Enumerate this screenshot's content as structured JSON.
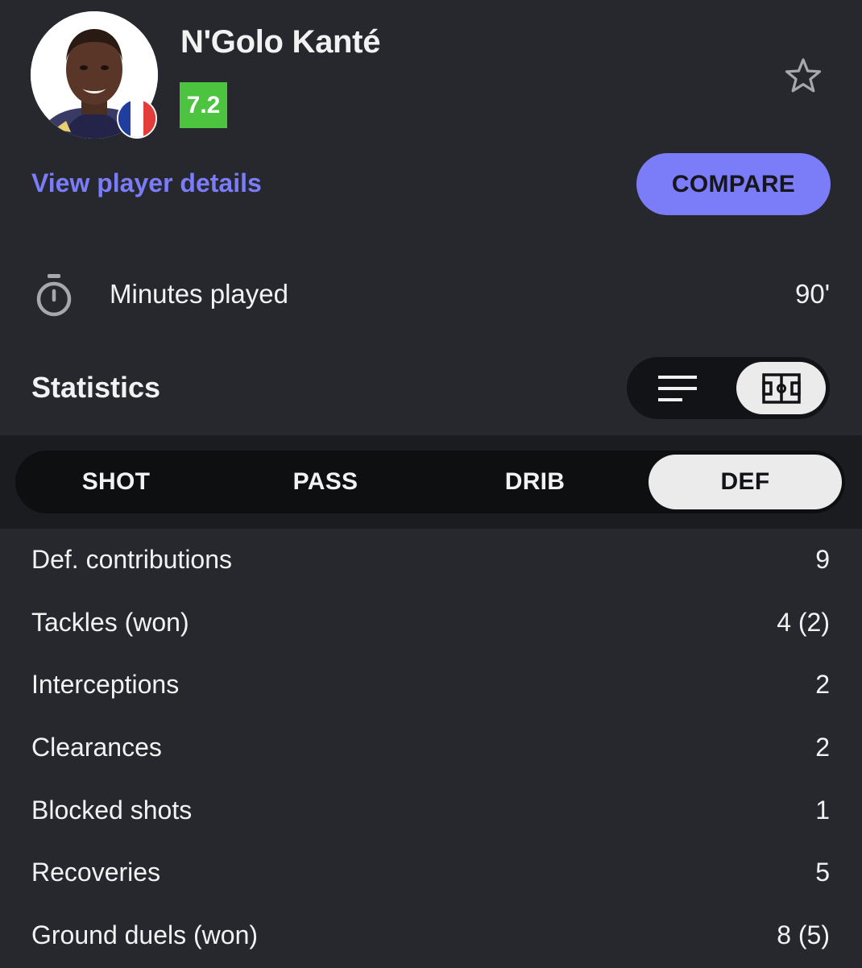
{
  "player": {
    "name": "N'Golo Kanté",
    "rating": "7.2",
    "rating_color": "#4cc43f",
    "country_flag": "france-flag-icon",
    "avatar": "player-photo"
  },
  "actions": {
    "view_details": "View player details",
    "compare": "COMPARE",
    "accent_color": "#7b7cf7",
    "favorite_icon": "star-outline-icon"
  },
  "minutes": {
    "icon": "stopwatch-icon",
    "label": "Minutes played",
    "value": "90'"
  },
  "statistics": {
    "title": "Statistics",
    "view_modes": [
      {
        "icon": "list-view-icon",
        "active": false
      },
      {
        "icon": "pitch-view-icon",
        "active": true
      }
    ]
  },
  "tabs": [
    {
      "label": "SHOT",
      "active": false
    },
    {
      "label": "PASS",
      "active": false
    },
    {
      "label": "DRIB",
      "active": false
    },
    {
      "label": "DEF",
      "active": true
    }
  ],
  "stats": [
    {
      "label": "Def. contributions",
      "value": "9"
    },
    {
      "label": "Tackles (won)",
      "value": "4 (2)"
    },
    {
      "label": "Interceptions",
      "value": "2"
    },
    {
      "label": "Clearances",
      "value": "2"
    },
    {
      "label": "Blocked shots",
      "value": "1"
    },
    {
      "label": "Recoveries",
      "value": "5"
    },
    {
      "label": "Ground duels (won)",
      "value": "8 (5)"
    }
  ]
}
